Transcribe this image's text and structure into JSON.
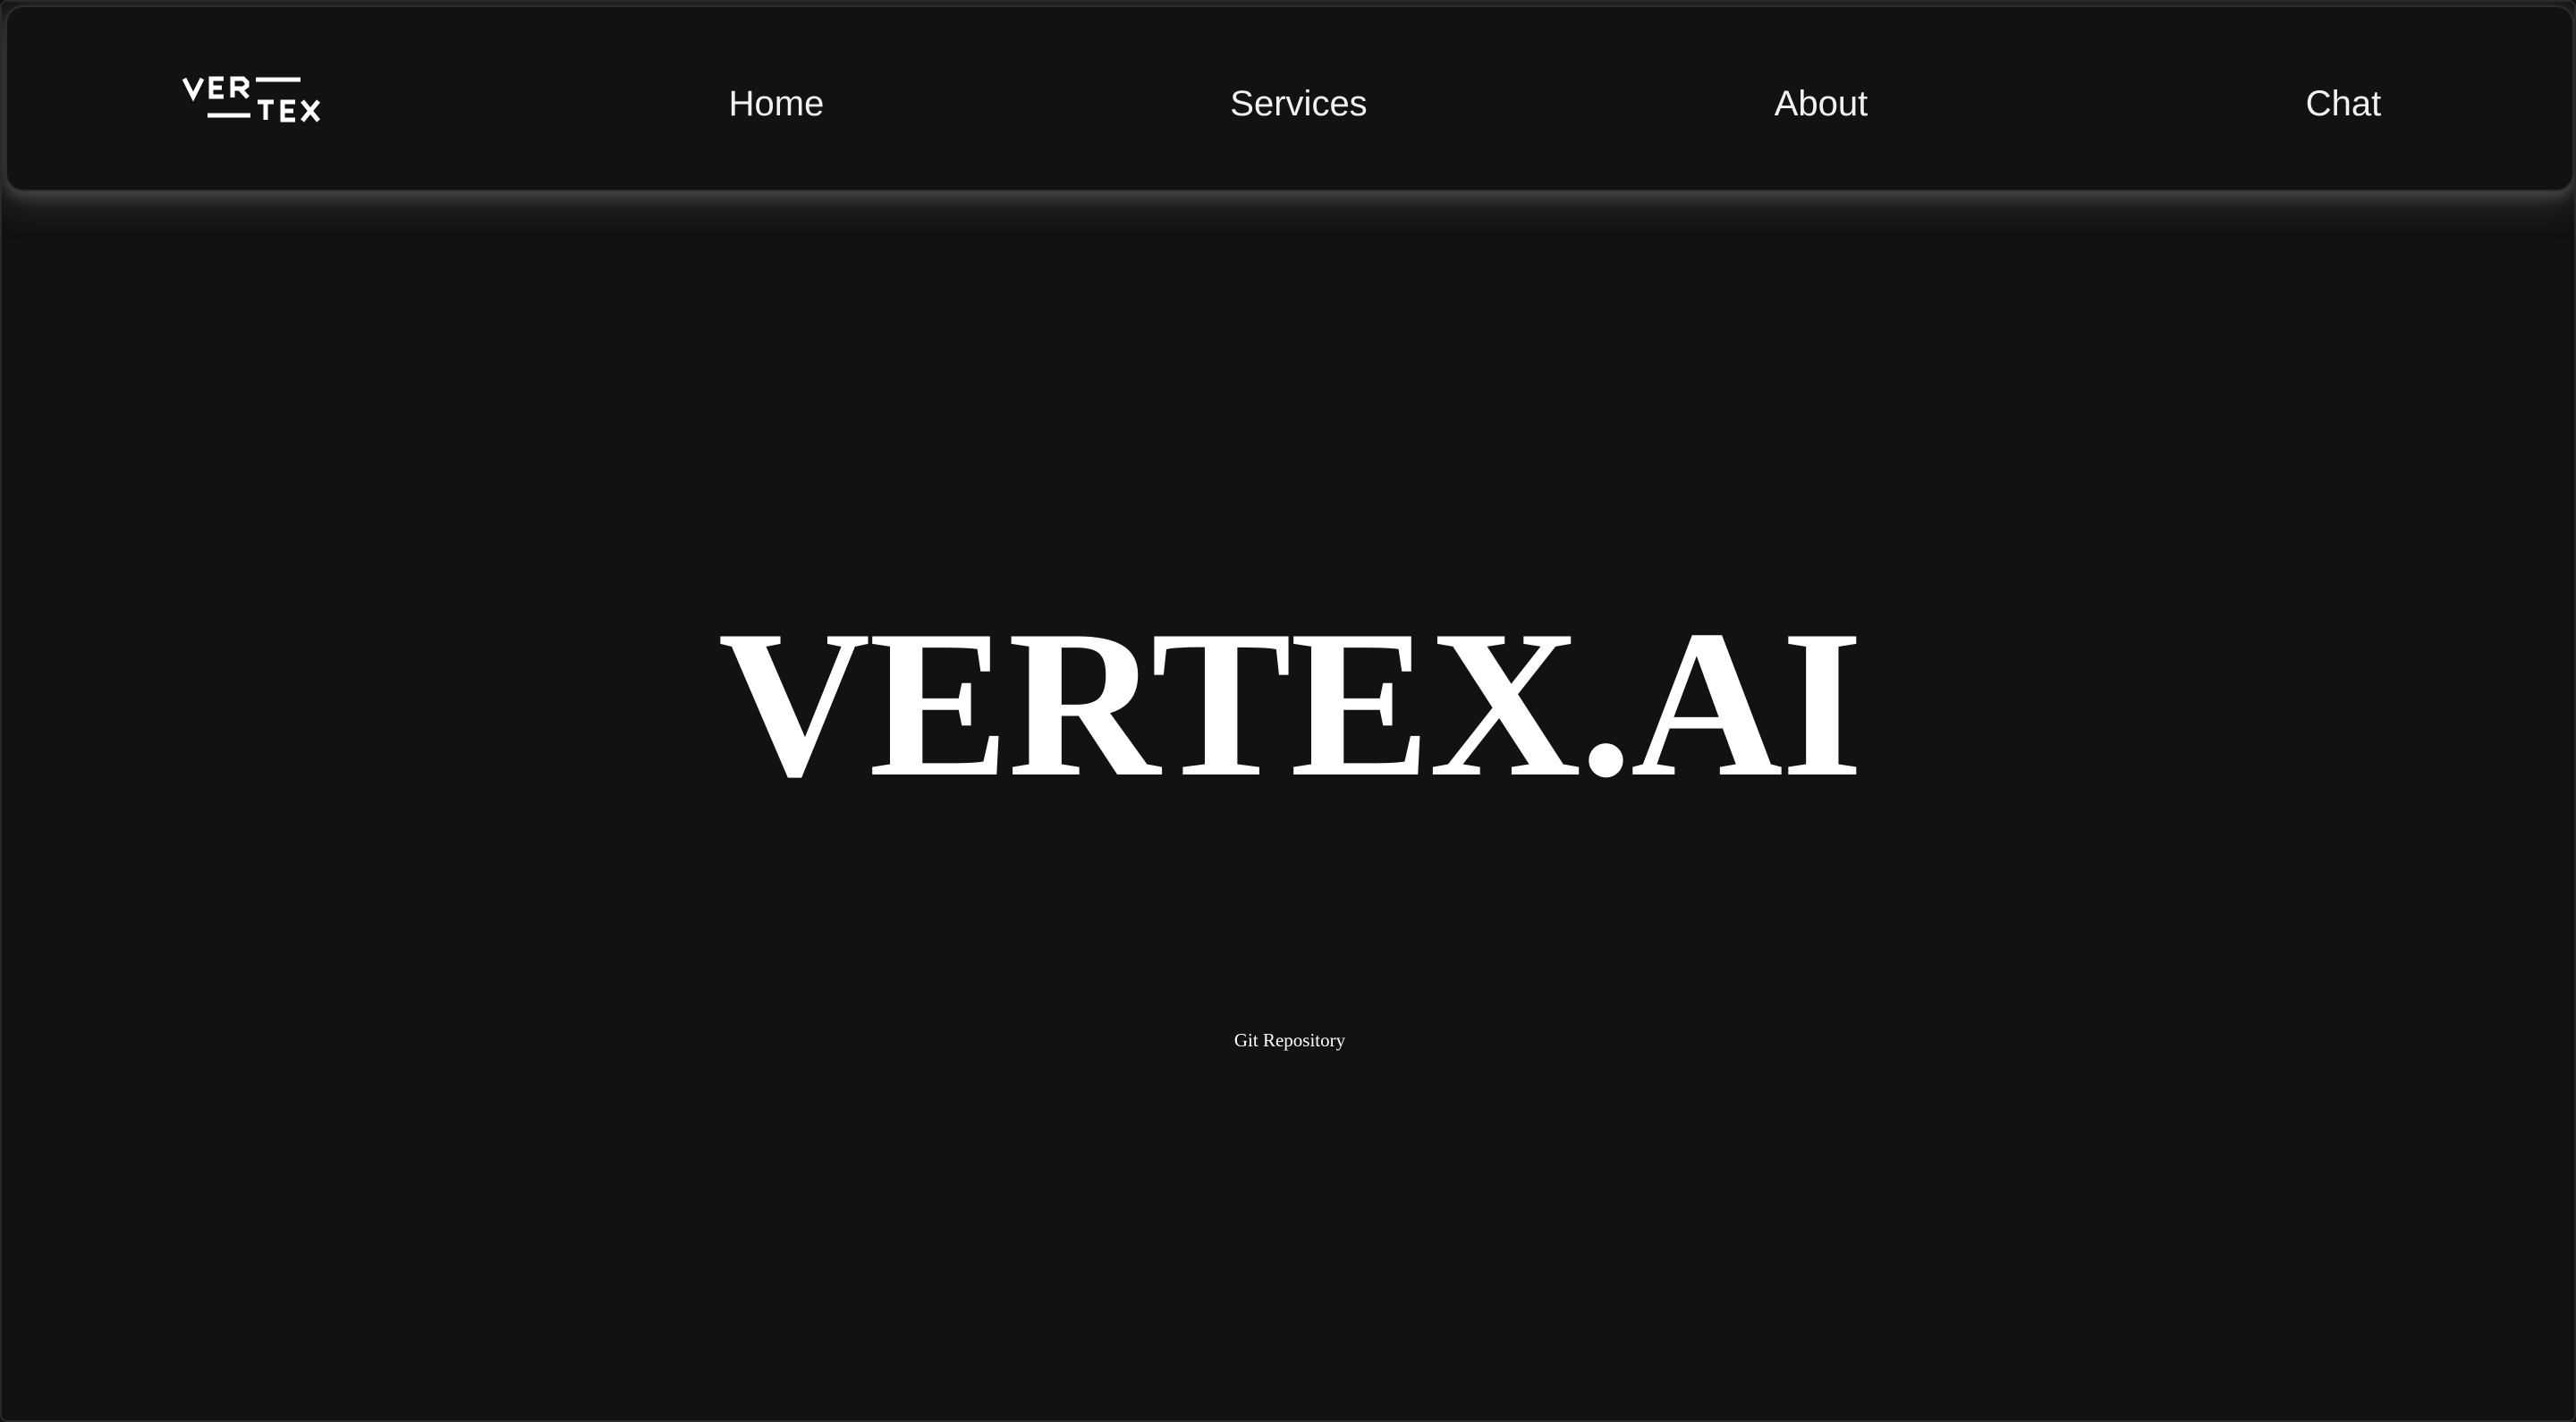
{
  "brand": {
    "logo_text": "VERTEX"
  },
  "nav": {
    "items": [
      {
        "label": "Home"
      },
      {
        "label": "Services"
      },
      {
        "label": "About"
      },
      {
        "label": "Chat"
      }
    ]
  },
  "hero": {
    "title": "VERTEX.AI",
    "link_label": "Git Repository"
  },
  "colors": {
    "background": "#121212",
    "text": "#ffffff",
    "navbar_glow": "#5a5a5a"
  }
}
